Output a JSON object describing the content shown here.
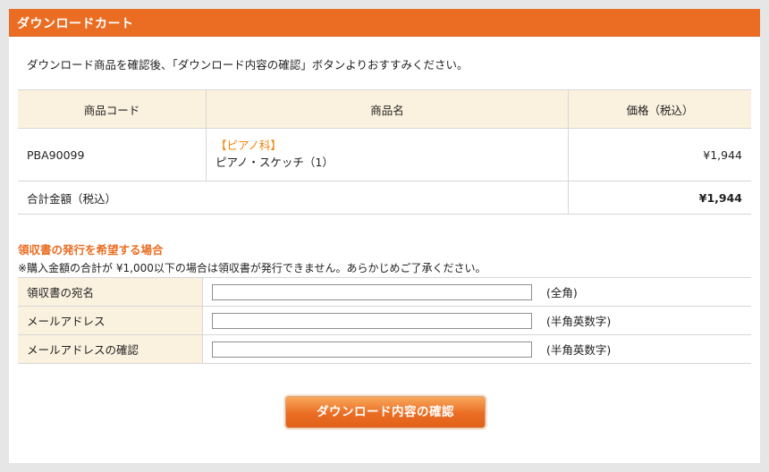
{
  "header": {
    "title": "ダウンロードカート"
  },
  "intro": "ダウンロード商品を確認後、「ダウンロード内容の確認」ボタンよりおすすみください。",
  "cart": {
    "columns": [
      "商品コード",
      "商品名",
      "価格（税込）"
    ],
    "item": {
      "code": "PBA90099",
      "category": "【ピアノ科】",
      "name": "ピアノ・スケッチ（1）",
      "price": "¥1,944"
    },
    "total": {
      "label": "合計金額（税込）",
      "value": "¥1,944"
    }
  },
  "receipt": {
    "title": "領収書の発行を希望する場合",
    "note": "※購入金額の合計が ¥1,000以下の場合は領収書が発行できません。あらかじめご了承ください。",
    "fields": [
      {
        "label": "領収書の宛名",
        "value": "",
        "hint": "(全角)"
      },
      {
        "label": "メールアドレス",
        "value": "",
        "hint": "(半角英数字)"
      },
      {
        "label": "メールアドレスの確認",
        "value": "",
        "hint": "(半角英数字)"
      }
    ]
  },
  "button": {
    "label": "ダウンロード内容の確認"
  }
}
